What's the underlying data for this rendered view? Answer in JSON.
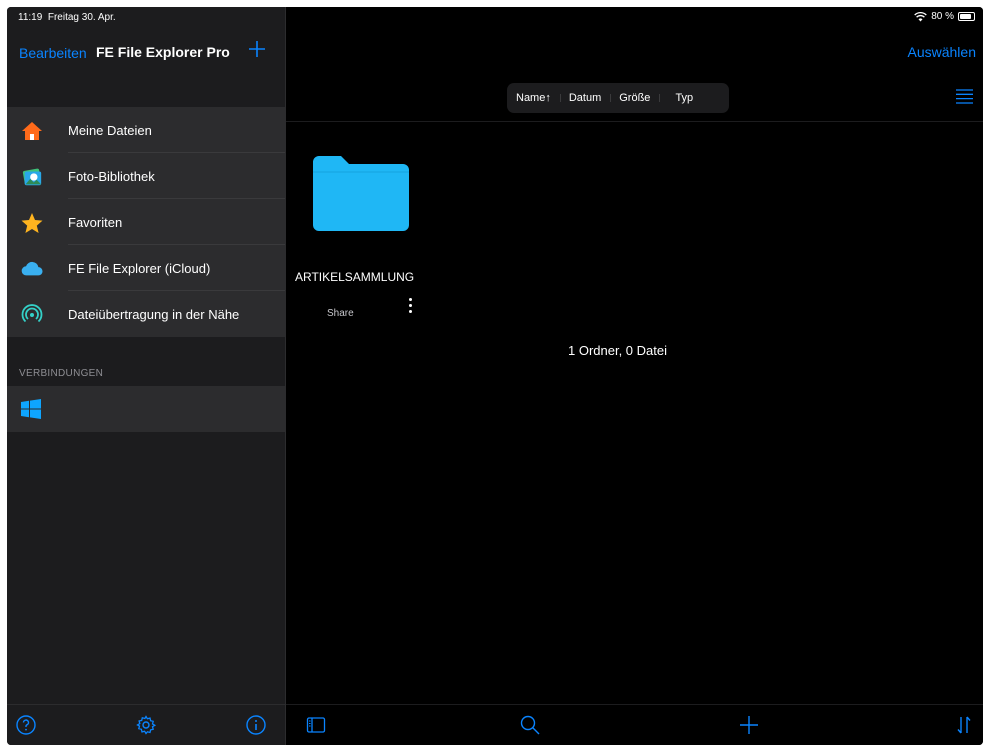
{
  "status_bar": {
    "time": "11:19",
    "date": "Freitag 30. Apr.",
    "battery": "80 %",
    "battery_level": 0.8
  },
  "sidebar": {
    "edit_label": "Bearbeiten",
    "app_title": "FE File Explorer Pro",
    "add_icon": "plus-icon",
    "items": [
      {
        "label": "Meine Dateien",
        "icon": "home-icon"
      },
      {
        "label": "Foto-Bibliothek",
        "icon": "photos-icon"
      },
      {
        "label": "Favoriten",
        "icon": "star-icon"
      },
      {
        "label": "FE File Explorer (iCloud)",
        "icon": "cloud-icon"
      },
      {
        "label": "Dateiübertragung in der Nähe",
        "icon": "nearby-transfer-icon"
      }
    ],
    "section_label": "VERBINDUNGEN",
    "connections": [
      {
        "icon": "windows-icon"
      }
    ],
    "footer_icons": [
      "help-icon",
      "settings-icon",
      "info-icon"
    ]
  },
  "main": {
    "select_label": "Auswählen",
    "sort": {
      "options": [
        "Name↑",
        "Datum",
        "Größe",
        "Typ"
      ]
    },
    "view_icon": "list-view-icon",
    "folder": {
      "name": "ARTIKELSAMMLUNG",
      "share_label": "Share"
    },
    "summary": "1 Ordner, 0 Datei",
    "footer_icons": [
      "sidebar-toggle-icon",
      "search-icon",
      "plus-icon",
      "sort-icon"
    ]
  },
  "colors": {
    "accent": "#0a84ff",
    "folder": "#1fb7f5",
    "background": "#000000",
    "sidebar": "#2c2c2e"
  }
}
